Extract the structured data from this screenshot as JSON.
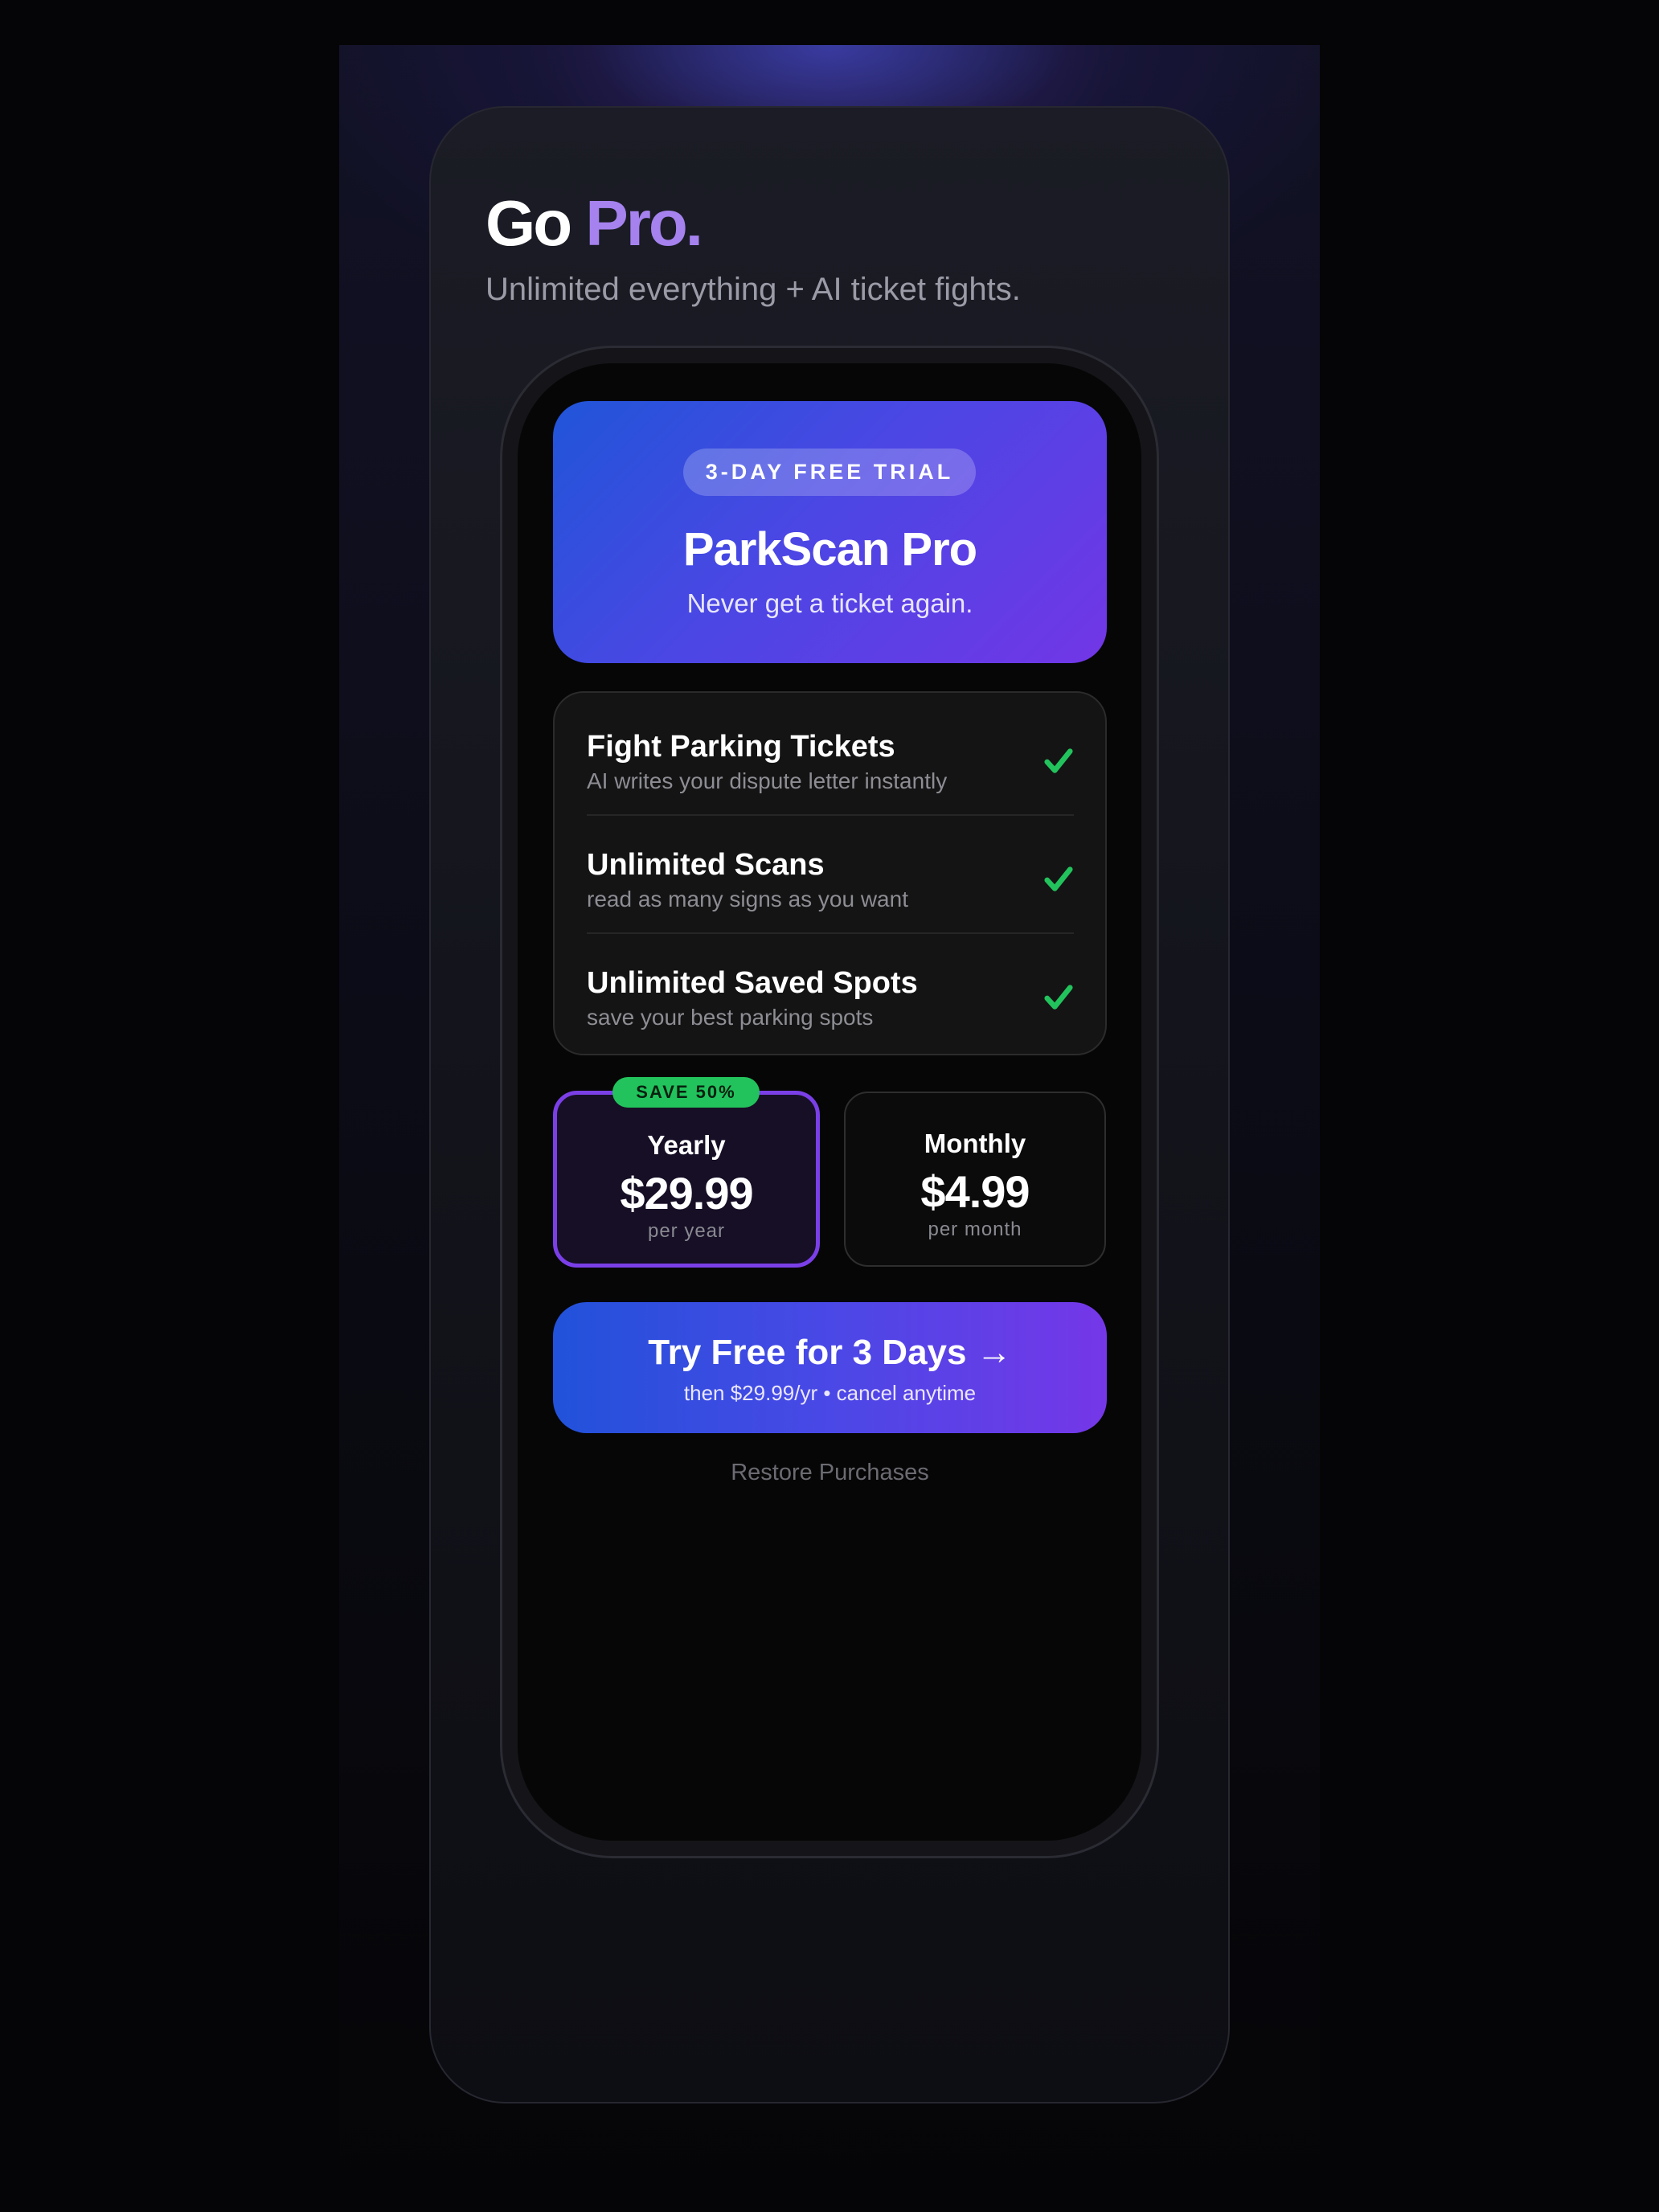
{
  "colors": {
    "accent_purple": "#a582ee",
    "gradient_start": "#2055d8",
    "gradient_end": "#7236e6",
    "check_green": "#22c35c",
    "selected_border": "#7b3fe8"
  },
  "header": {
    "title_part1": "Go",
    "title_part2": "Pro.",
    "subtitle": "Unlimited everything + AI ticket fights."
  },
  "hero": {
    "badge": "3-DAY FREE TRIAL",
    "title": "ParkScan Pro",
    "subtitle": "Never get a ticket again."
  },
  "features": [
    {
      "name": "Fight Parking Tickets",
      "desc": "AI writes your dispute letter instantly",
      "icon": "check-icon"
    },
    {
      "name": "Unlimited Scans",
      "desc": "read as many signs as you want",
      "icon": "check-icon"
    },
    {
      "name": "Unlimited Saved Spots",
      "desc": "save your best parking spots",
      "icon": "check-icon"
    }
  ],
  "plans": {
    "yearly": {
      "badge": "SAVE 50%",
      "name": "Yearly",
      "price": "$29.99",
      "period": "per year",
      "selected": true
    },
    "monthly": {
      "name": "Monthly",
      "price": "$4.99",
      "period": "per month",
      "selected": false
    }
  },
  "cta": {
    "label": "Try Free for 3 Days →",
    "sublabel": "then $29.99/yr • cancel anytime"
  },
  "restore_label": "Restore Purchases"
}
